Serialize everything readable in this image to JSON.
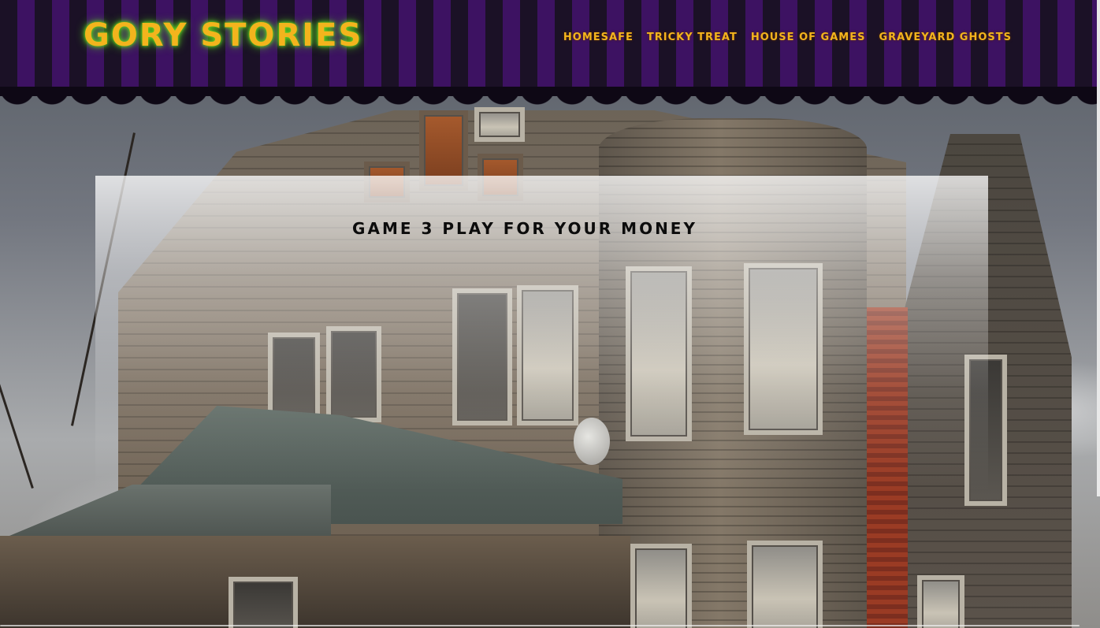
{
  "brand": {
    "logo_text": "GORY STORIES"
  },
  "nav": {
    "items": [
      {
        "label": "HOMESAFE"
      },
      {
        "label": "TRICKY TREAT"
      },
      {
        "label": "HOUSE OF GAMES"
      },
      {
        "label": "GRAVEYARD GHOSTS"
      }
    ]
  },
  "main": {
    "title": "GAME 3 PLAY FOR YOUR MONEY"
  },
  "colors": {
    "stripe_dark": "#1b1126",
    "stripe_purple": "#3d1262",
    "accent_orange": "#f3b41d",
    "glow_green": "#6be02a"
  }
}
